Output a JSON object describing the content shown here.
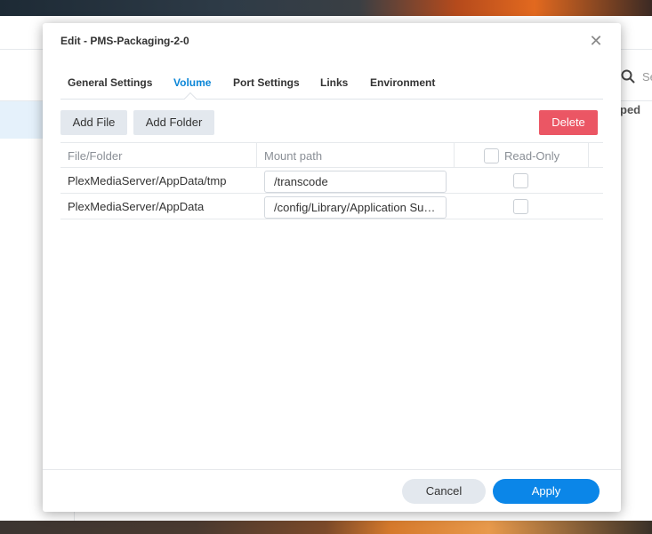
{
  "background": {
    "search_placeholder": "Se",
    "column_header_partial": "ped"
  },
  "dialog": {
    "title": "Edit - PMS-Packaging-2-0",
    "close_glyph": "✕",
    "tabs": [
      {
        "label": "General Settings",
        "active": false
      },
      {
        "label": "Volume",
        "active": true
      },
      {
        "label": "Port Settings",
        "active": false
      },
      {
        "label": "Links",
        "active": false
      },
      {
        "label": "Environment",
        "active": false
      }
    ],
    "toolbar": {
      "add_file": "Add File",
      "add_folder": "Add Folder",
      "delete": "Delete"
    },
    "table": {
      "headers": {
        "file_folder": "File/Folder",
        "mount_path": "Mount path",
        "read_only": "Read-Only"
      },
      "rows": [
        {
          "file_folder": "PlexMediaServer/AppData/tmp",
          "mount_path": "/transcode",
          "read_only": false
        },
        {
          "file_folder": "PlexMediaServer/AppData",
          "mount_path": "/config/Library/Application Support",
          "read_only": false
        }
      ]
    },
    "footer": {
      "cancel": "Cancel",
      "apply": "Apply"
    }
  },
  "colors": {
    "accent": "#0b86e8",
    "danger": "#e8394a",
    "active_tab": "#0b86d7"
  }
}
